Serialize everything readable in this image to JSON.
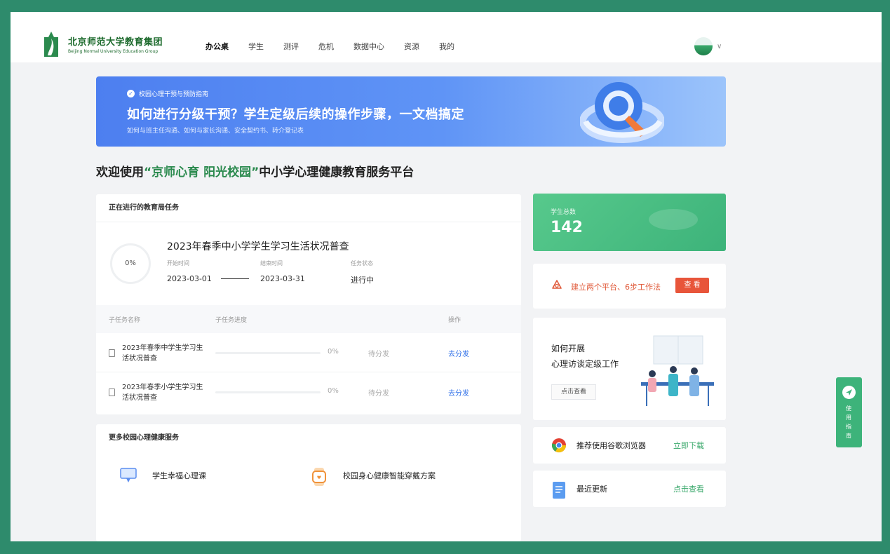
{
  "header": {
    "logo_cn": "北京师范大学教育集团",
    "logo_en": "Beijing Normal University Education Group",
    "nav": [
      "办公桌",
      "学生",
      "测评",
      "危机",
      "数据中心",
      "资源",
      "我的"
    ],
    "active_nav": "办公桌"
  },
  "banner": {
    "tag": "校园心理干预与预防指南",
    "title": "如何进行分级干预？学生定级后续的操作步骤，一文档搞定",
    "subtitle": "如何与班主任沟通、如何与家长沟通、安全契约书、转介登记表"
  },
  "welcome": {
    "prefix": "欢迎使用",
    "highlight": "“京师心育 阳光校园”",
    "suffix": "中小学心理健康教育服务平台"
  },
  "task": {
    "section_title": "正在进行的教育局任务",
    "progress_label": "0%",
    "progress_value": 0,
    "title": "2023年春季中小学学生学习生活状况普查",
    "start_label": "开始时间",
    "start_value": "2023-03-01",
    "end_label": "结束时间",
    "end_value": "2023-03-31",
    "status_label": "任务状态",
    "status_value": "进行中",
    "columns": [
      "子任务名称",
      "子任务进度",
      "操作"
    ],
    "subtasks": [
      {
        "name": "2023年春季中学生学习生活状况普查",
        "progress": 0,
        "progress_label": "0%",
        "status": "待分发",
        "action": "去分发"
      },
      {
        "name": "2023年春季小学生学习生活状况普查",
        "progress": 0,
        "progress_label": "0%",
        "status": "待分发",
        "action": "去分发"
      }
    ]
  },
  "services": {
    "section_title": "更多校园心理健康服务",
    "items": [
      {
        "label": "学生幸福心理课",
        "icon": "monitor-icon"
      },
      {
        "label": "校园身心健康智能穿戴方案",
        "icon": "smartwatch-icon"
      }
    ]
  },
  "stats": {
    "label": "学生总数",
    "value": "142"
  },
  "method": {
    "text": "建立两个平台、6步工作法",
    "button": "查 看"
  },
  "guide": {
    "line1": "如何开展",
    "line2": "心理访谈定级工作",
    "button": "点击查看"
  },
  "browser": {
    "text": "推荐使用谷歌浏览器",
    "link": "立即下载"
  },
  "updates": {
    "text": "最近更新",
    "link": "点击查看"
  },
  "side_guide": {
    "text": "使用指南"
  },
  "colors": {
    "frame": "#2e8b6c",
    "brand_green": "#2b8a4e",
    "stat_green": "#3db37a",
    "banner_blue": "#4d7ff0",
    "accent_red": "#e8553a",
    "link_blue": "#2f6fe8"
  }
}
